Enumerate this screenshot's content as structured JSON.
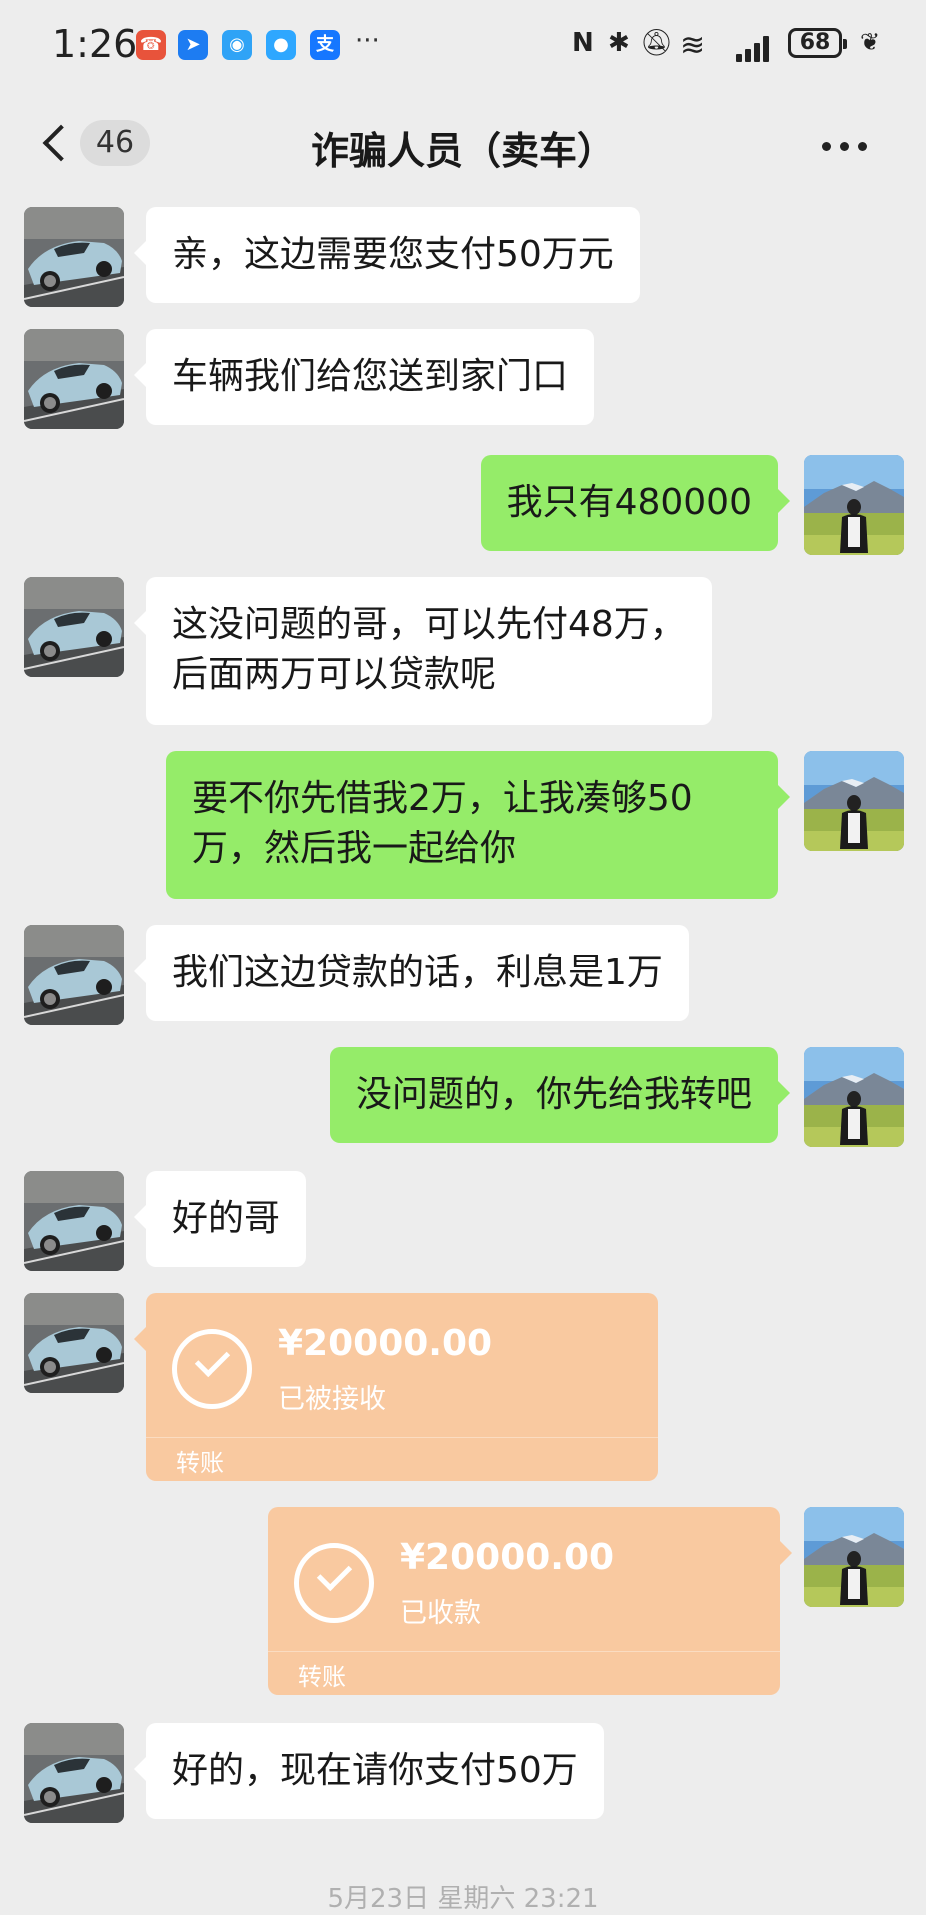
{
  "status_bar": {
    "time": "1:26",
    "notification_icons": [
      "missed-call-icon",
      "dingtalk-icon",
      "map-pin-icon",
      "message-icon",
      "alipay-icon"
    ],
    "overflow": "···",
    "battery": "68"
  },
  "header": {
    "unread_count": "46",
    "title": "诈骗人员（卖车）"
  },
  "messages": [
    {
      "side": "left",
      "type": "text",
      "text": "亲，这边需要您支付50万元"
    },
    {
      "side": "left",
      "type": "text",
      "text": "车辆我们给您送到家门口"
    },
    {
      "side": "right",
      "type": "text",
      "text": "我只有480000"
    },
    {
      "side": "left",
      "type": "text",
      "line1": "这没问题的哥，可以先付48万，",
      "line2": "后面两万可以贷款呢"
    },
    {
      "side": "right",
      "type": "text",
      "line1": "要不你先借我2万，让我凑够50",
      "line2": "万，然后我一起给你"
    },
    {
      "side": "left",
      "type": "text",
      "text": "我们这边贷款的话，利息是1万"
    },
    {
      "side": "right",
      "type": "text",
      "text": "没问题的，你先给我转吧"
    },
    {
      "side": "left",
      "type": "text",
      "text": "好的哥"
    },
    {
      "side": "left",
      "type": "transfer",
      "amount": "¥20000.00",
      "status": "已被接收",
      "label": "转账"
    },
    {
      "side": "right",
      "type": "transfer",
      "amount": "¥20000.00",
      "status": "已收款",
      "label": "转账"
    },
    {
      "side": "left",
      "type": "text",
      "text": "好的，现在请你支付50万"
    }
  ],
  "timestamp": "5月23日 星期六 23:21",
  "colors": {
    "background": "#ededed",
    "outgoing_bubble": "#95ec69",
    "incoming_bubble": "#ffffff",
    "transfer_card": "#f9c9a0"
  }
}
